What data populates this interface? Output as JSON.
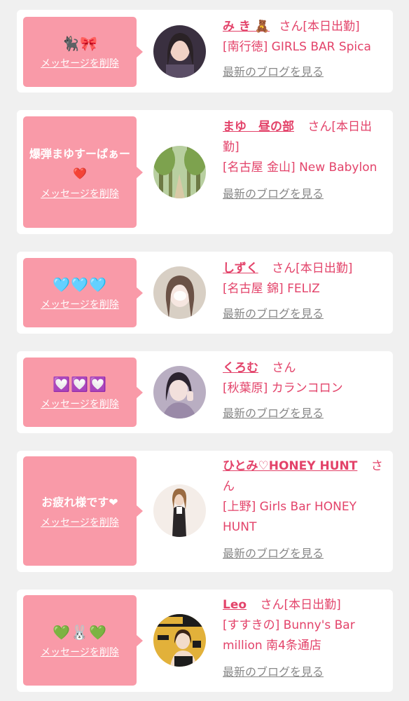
{
  "items": [
    {
      "message": "🐈‍⬛🎀",
      "delete_label": "メッセージを削除",
      "name": "み き 🧸",
      "honorific": "さん",
      "today_label": "[本日出勤]",
      "shop": "[南行徳] GIRLS BAR Spica",
      "blog_label": "最新のブログを見る",
      "avatar_color": "#3a3040"
    },
    {
      "message": "爆弾まゆすーぱぁー❤️",
      "delete_label": "メッセージを削除",
      "name": "まゆ　昼の部",
      "honorific": "さん",
      "today_label": "[本日出勤]",
      "shop": "[名古屋 金山] New Babylon",
      "blog_label": "最新のブログを見る",
      "avatar_color": "#7da24e"
    },
    {
      "message": "🩵🩵🩵",
      "delete_label": "メッセージを削除",
      "name": "しずく",
      "honorific": "さん",
      "today_label": "[本日出勤]",
      "shop": "[名古屋 錦] FELIZ",
      "blog_label": "最新のブログを見る",
      "avatar_color": "#c8b8a8"
    },
    {
      "message": "💟💟💟",
      "delete_label": "メッセージを削除",
      "name": "くろむ",
      "honorific": "さん",
      "today_label": "",
      "shop": "[秋葉原] カランコロン",
      "blog_label": "最新のブログを見る",
      "avatar_color": "#9a8aa8"
    },
    {
      "message": "お疲れ様です❤",
      "delete_label": "メッセージを削除",
      "name": "ひとみ♡HONEY HUNT",
      "honorific": "さん",
      "today_label": "",
      "shop": "[上野] Girls Bar HONEY HUNT",
      "blog_label": "最新のブログを見る",
      "avatar_color": "#f4ede8"
    },
    {
      "message": "💚🐰💚",
      "delete_label": "メッセージを削除",
      "name": "Leo",
      "honorific": "さん",
      "today_label": "[本日出勤]",
      "shop": "[すすきの] Bunny's Bar million 南4条通店",
      "blog_label": "最新のブログを見る",
      "avatar_color": "#e2b13a"
    }
  ]
}
